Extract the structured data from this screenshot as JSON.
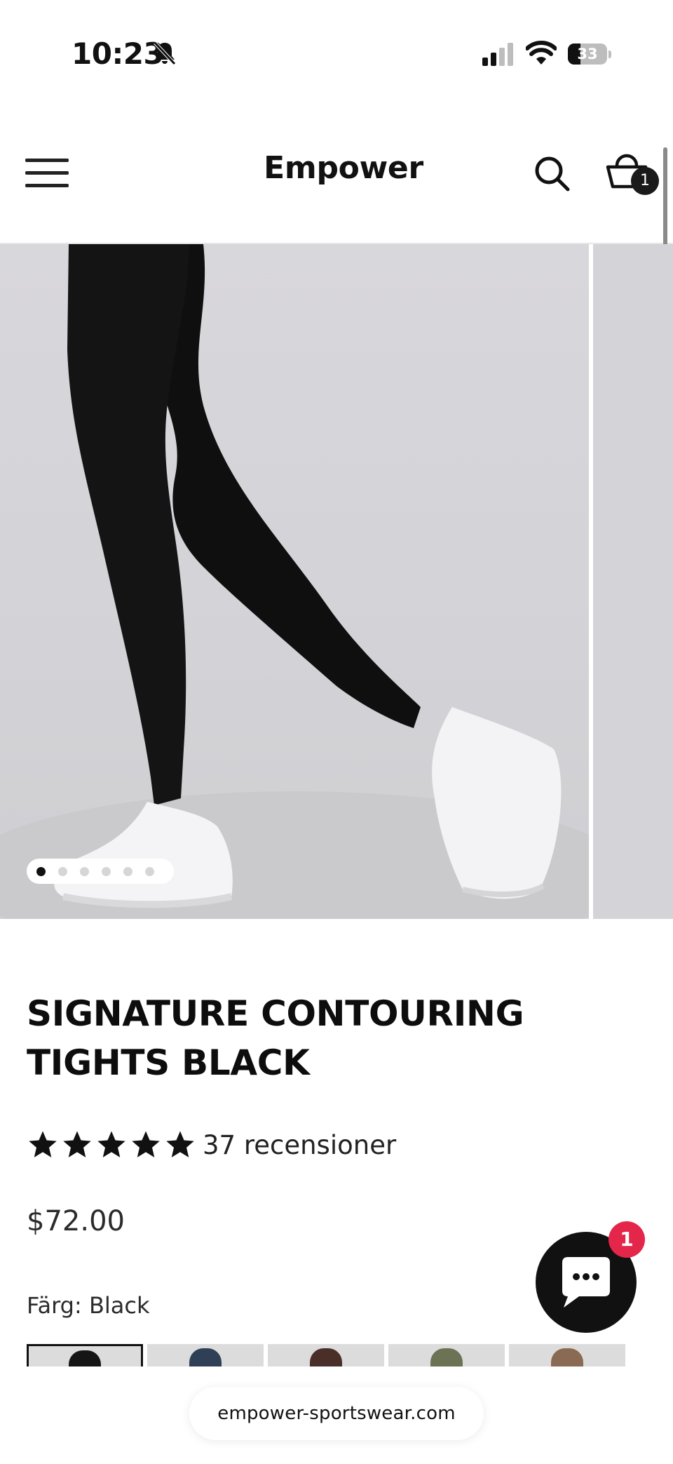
{
  "status_bar": {
    "time": "10:23",
    "battery_level": "33",
    "battery_fraction": 0.33,
    "icons": [
      "bell-slash-icon",
      "signal-icon",
      "wifi-icon",
      "battery-icon"
    ]
  },
  "header": {
    "brand": "Empower",
    "cart_count": "1",
    "icons": [
      "menu-icon",
      "search-icon",
      "cart-icon"
    ]
  },
  "gallery": {
    "slide_count": 6,
    "active_index": 0
  },
  "product": {
    "title": "SIGNATURE CONTOURING TIGHTS BLACK",
    "rating": 5,
    "reviews_text": "37 recensioner",
    "price": "$72.00",
    "color_label": "Färg: Black"
  },
  "swatches": [
    {
      "color": "#151515",
      "selected": true
    },
    {
      "color": "#2f3f55",
      "selected": false
    },
    {
      "color": "#4a2e28",
      "selected": false
    },
    {
      "color": "#6c7254",
      "selected": false
    },
    {
      "color": "#8a6a52",
      "selected": false
    }
  ],
  "chat": {
    "badge": "1"
  },
  "browser": {
    "domain": "empower-sportswear.com"
  },
  "colors": {
    "accent": "#111111",
    "badge": "#e4264a",
    "image_bg": "#d6d6d9"
  }
}
